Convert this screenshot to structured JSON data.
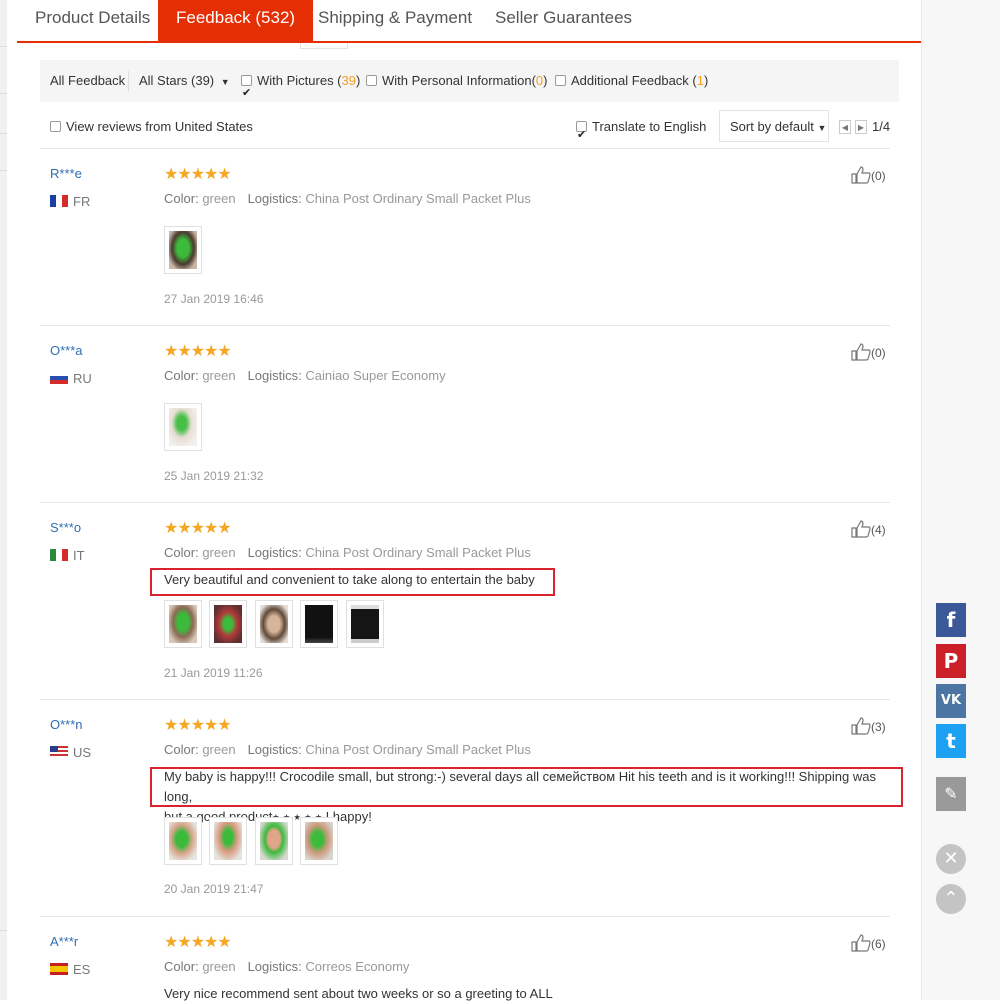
{
  "tabs": [
    {
      "label": "Product Details"
    },
    {
      "label": "Feedback (532)"
    },
    {
      "label": "Shipping & Payment"
    },
    {
      "label": "Seller Guarantees"
    }
  ],
  "filters": {
    "all_feedback": "All Feedback",
    "all_stars": "All Stars (39)",
    "with_pictures": "With Pictures (",
    "with_pictures_count": "39",
    "with_personal": "With Personal Information(",
    "with_personal_count": "0",
    "additional": "Additional Feedback (",
    "additional_count": "1",
    "close_paren": ")",
    "view_us": "View reviews from United States",
    "translate": "Translate to English",
    "sort": "Sort by default",
    "page": "1/4"
  },
  "reviews": [
    {
      "user": "R***e",
      "country": "FR",
      "stars": "★★★★★",
      "color_label": "Color:",
      "color": "green",
      "logistics_label": "Logistics:",
      "logistics": "China Post Ordinary Small Packet Plus",
      "helpful": "(0)",
      "date": "27 Jan 2019 16:46",
      "comment": ""
    },
    {
      "user": "O***a",
      "country": "RU",
      "stars": "★★★★★",
      "color_label": "Color:",
      "color": "green",
      "logistics_label": "Logistics:",
      "logistics": "Cainiao Super Economy",
      "helpful": "(0)",
      "date": "25 Jan 2019 21:32",
      "comment": ""
    },
    {
      "user": "S***o",
      "country": "IT",
      "stars": "★★★★★",
      "color_label": "Color:",
      "color": "green",
      "logistics_label": "Logistics:",
      "logistics": "China Post Ordinary Small Packet Plus",
      "helpful": "(4)",
      "date": "21 Jan 2019 11:26",
      "comment": "Very beautiful and convenient to take along to entertain the baby"
    },
    {
      "user": "O***n",
      "country": "US",
      "stars": "★★★★★",
      "color_label": "Color:",
      "color": "green",
      "logistics_label": "Logistics:",
      "logistics": "China Post Ordinary Small Packet Plus",
      "helpful": "(3)",
      "date": "20 Jan 2019 21:47",
      "comment": "My baby is happy!!! Crocodile small, but strong:-) several days all семейством Hit his teeth and is it working!!! Shipping was long,",
      "comment2": "but a good product⭑ ⭑ ⭑ ⭑ ⭑ I happy!"
    },
    {
      "user": "A***r",
      "country": "ES",
      "stars": "★★★★★",
      "color_label": "Color:",
      "color": "green",
      "logistics_label": "Logistics:",
      "logistics": "Correos Economy",
      "helpful": "(6)",
      "date": "",
      "comment": "Very nice recommend sent about two weeks or so a greeting to ALL"
    }
  ],
  "social": {
    "facebook": "f",
    "pinterest": "P",
    "vk": "VK",
    "twitter": "t"
  },
  "colors": {
    "accent": "#e62e04",
    "star": "#f5a623",
    "username": "#2f6fb3",
    "highlight_box": "#d9232f"
  }
}
